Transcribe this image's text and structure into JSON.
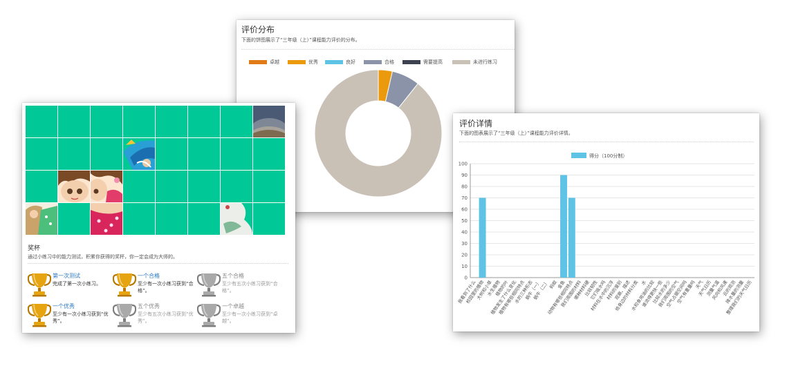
{
  "distribution": {
    "title": "评价分布",
    "subtitle": "下面的饼图展示了“三年级（上）”课程能力评价的分布。",
    "legend": [
      {
        "label": "卓越",
        "color": "#e07b17"
      },
      {
        "label": "优秀",
        "color": "#eb9a0e"
      },
      {
        "label": "良好",
        "color": "#5fc3e6"
      },
      {
        "label": "合格",
        "color": "#8a93a8"
      },
      {
        "label": "需要提高",
        "color": "#3d4250"
      },
      {
        "label": "未进行练习",
        "color": "#c9c0b6"
      }
    ]
  },
  "chart_data": [
    {
      "type": "pie",
      "title": "",
      "categories": [
        "卓越",
        "优秀",
        "良好",
        "合格",
        "需要提高",
        "未进行练习"
      ],
      "values": [
        0,
        1,
        0,
        2,
        0,
        25
      ],
      "donut": true
    },
    {
      "type": "bar",
      "title": "",
      "series": [
        {
          "name": "得分（100分制）",
          "color": "#5fc3e6",
          "values": [
            0,
            70,
            0,
            0,
            0,
            0,
            0,
            0,
            0,
            0,
            0,
            90,
            70,
            0,
            0,
            0,
            0,
            0,
            0,
            0,
            0,
            0,
            0,
            0,
            0,
            0,
            0,
            0,
            0,
            0,
            0,
            0,
            0,
            0,
            0
          ]
        }
      ],
      "categories": [
        "我看到了什么",
        "校园里的植物",
        "大树和小草",
        "水生植物",
        "植物的叶",
        "植物发生了什么变化",
        "植物有哪些相同特点",
        "水的三种形态",
        "蜗牛（一）",
        "蜗牛（二）",
        "蚂蚁",
        "金鱼",
        "动物有哪些相同特点",
        "我们周围的材料",
        "哪种材料硬",
        "比较韧性",
        "它们吸水吗",
        "材料在水中的沉浮",
        "材料的鉴别",
        "观察、描述",
        "给身边的材料分类",
        "水",
        "水和食用油的比较",
        "谁流得更快一些",
        "比较水的多少",
        "我们周围的空气",
        "空气占据空间吗",
        "空气有重量吗",
        "天气",
        "天气日历",
        "测量气温",
        "风向和风速",
        "云的观测",
        "降水量的测量",
        "整理我们的天气日历"
      ],
      "ylim": [
        0,
        100
      ],
      "yticks": [
        0,
        10,
        20,
        30,
        40,
        50,
        60,
        70,
        80,
        90,
        100
      ],
      "legend_position": "top-center",
      "grid": true
    }
  ],
  "detail": {
    "title": "评价详情",
    "subtitle": "下面的图表展示了“三年级（上）”课程能力评价详情。",
    "legend_label": "得分（100分制）"
  },
  "awards": {
    "title": "奖杯",
    "description": "通过小练习中的能力测试，积累你获得的奖杯，你一定会成为大师的。",
    "items": [
      {
        "name": "第一次测试",
        "desc": "完成了第一次小练习。",
        "cup": "gold",
        "state": "earned"
      },
      {
        "name": "一个合格",
        "desc": "至少有一次小练习获到“合格”。",
        "cup": "gold",
        "state": "earned"
      },
      {
        "name": "五个合格",
        "desc": "至少有五次小练习获到“合格”。",
        "cup": "silver",
        "state": "locked"
      },
      {
        "name": "一个优秀",
        "desc": "至少有一次小练习获到“优秀”。",
        "cup": "gold",
        "state": "earned"
      },
      {
        "name": "五个优秀",
        "desc": "至少有五次小练习获到“优秀”。",
        "cup": "silver",
        "state": "locked"
      },
      {
        "name": "一个卓越",
        "desc": "至少有一次小练习获到“卓越”。",
        "cup": "silver",
        "state": "locked"
      }
    ]
  },
  "colors": {
    "tile": "#00c896",
    "gold": "#e6a411",
    "silver": "#a9a9a9"
  }
}
